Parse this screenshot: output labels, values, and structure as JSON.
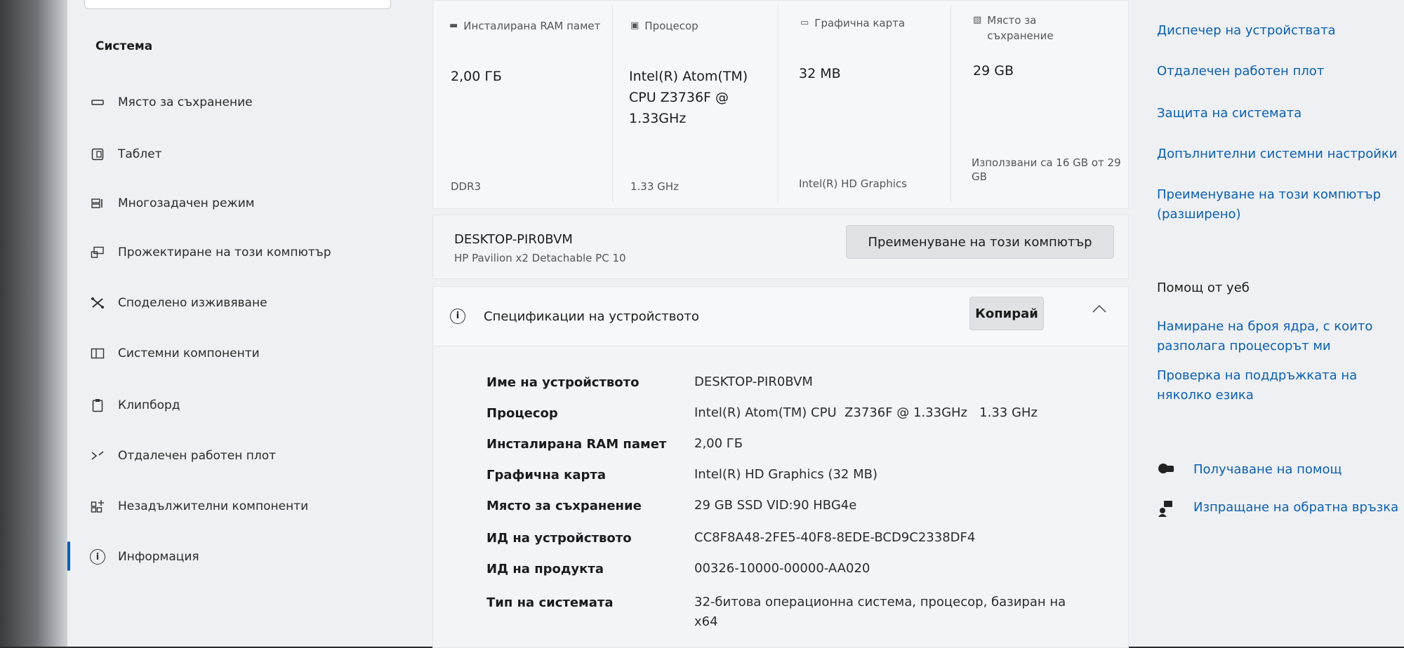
{
  "sidebar": {
    "title": "Система",
    "items": [
      {
        "label": "Място за съхранение",
        "icon": "storage-icon"
      },
      {
        "label": "Таблет",
        "icon": "tablet-icon"
      },
      {
        "label": "Многозадачен режим",
        "icon": "multitasking-icon"
      },
      {
        "label": "Прожектиране на този компютър",
        "icon": "projection-icon"
      },
      {
        "label": "Споделено изживяване",
        "icon": "shared-experience-icon"
      },
      {
        "label": "Системни компоненти",
        "icon": "system-components-icon"
      },
      {
        "label": "Клипборд",
        "icon": "clipboard-icon"
      },
      {
        "label": "Отдалечен работен плот",
        "icon": "remote-desktop-icon"
      },
      {
        "label": "Незадължителни компоненти",
        "icon": "optional-components-icon"
      },
      {
        "label": "Информация",
        "icon": "info-icon"
      }
    ]
  },
  "cards": {
    "ram": {
      "header": "Инсталирана RAM памет",
      "value": "2,00 ГБ",
      "sub": "DDR3"
    },
    "cpu": {
      "header": "Процесор",
      "value": "Intel(R) Atom(TM) CPU Z3736F @ 1.33GHz",
      "sub": "1.33 GHz"
    },
    "gpu": {
      "header": "Графична карта",
      "value": "32 MB",
      "sub": "Intel(R) HD Graphics"
    },
    "storage": {
      "header": "Място за съхранение",
      "value": "29 GB",
      "sub": "Използвани са 16 GB от 29 GB"
    }
  },
  "pc": {
    "name": "DESKTOP-PIR0BVM",
    "model": "HP Pavilion x2 Detachable PC 10",
    "rename_label": "Преименуване на този компютър"
  },
  "specs": {
    "title": "Спецификации на устройството",
    "copy_label": "Копирай",
    "rows": [
      {
        "label": "Име на устройството",
        "value": "DESKTOP-PIR0BVM"
      },
      {
        "label": "Процесор",
        "value": "Intel(R) Atom(TM) CPU  Z3736F @ 1.33GHz   1.33 GHz"
      },
      {
        "label": "Инсталирана RAM памет",
        "value": "2,00 ГБ"
      },
      {
        "label": "Графична карта",
        "value": "Intel(R) HD Graphics (32 MB)"
      },
      {
        "label": "Място за съхранение",
        "value": "29 GB SSD VID:90 HBG4e"
      },
      {
        "label": "ИД на устройството",
        "value": "CC8F8A48-2FE5-40F8-8EDE-BCD9C2338DF4"
      },
      {
        "label": "ИД на продукта",
        "value": "00326-10000-00000-AA020"
      },
      {
        "label": "Тип на системата",
        "value": "32-битова операционна система, процесор, базиран на x64"
      }
    ]
  },
  "related": {
    "links": [
      "Диспечер на устройствата",
      "Отдалечен работен плот",
      "Защита на системата",
      "Допълнителни системни настройки",
      "Преименуване на този компютър (разширено)"
    ]
  },
  "web_help": {
    "title": "Помощ от уеб",
    "links": [
      "Намиране на броя ядра, с които разполага процесорът ми",
      "Проверка на поддръжката на няколко езика"
    ]
  },
  "support": {
    "get_help": "Получаване на помощ",
    "feedback": "Изпращане на обратна връзка"
  }
}
